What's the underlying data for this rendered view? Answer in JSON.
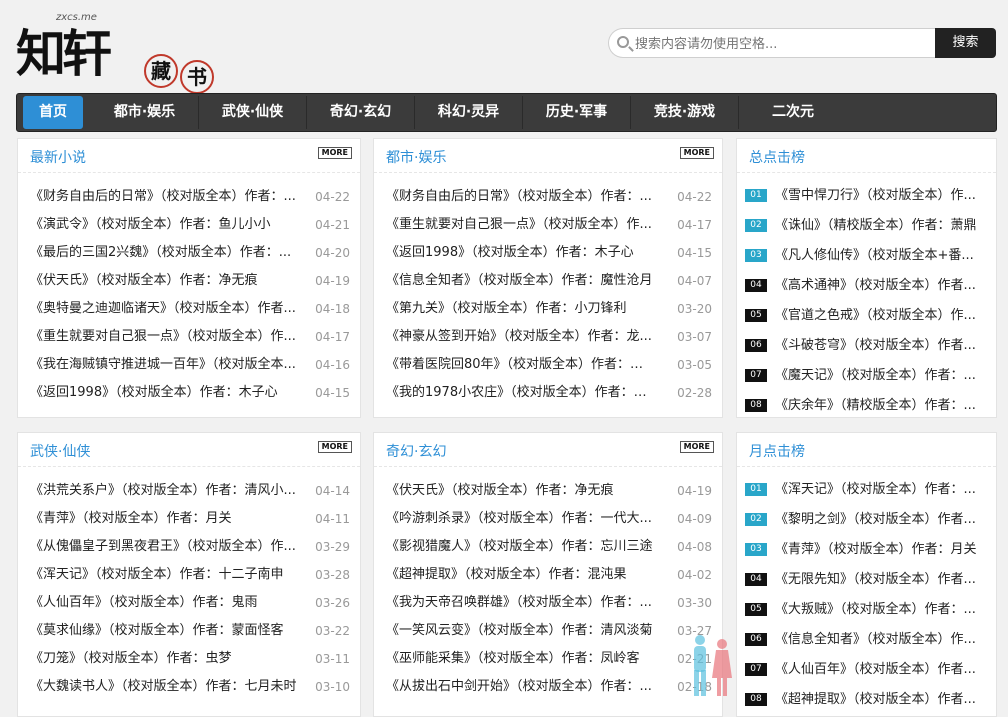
{
  "logo": {
    "main": "知轩",
    "url": "zxcs.me",
    "seal1": "藏",
    "seal2": "书"
  },
  "search": {
    "placeholder": "搜索内容请勿使用空格...",
    "button": "搜索"
  },
  "nav": [
    "首页",
    "都市·娱乐",
    "武侠·仙侠",
    "奇幻·玄幻",
    "科幻·灵异",
    "历史·军事",
    "竞技·游戏",
    "二次元"
  ],
  "more_label": "MORE",
  "panels": {
    "latest": {
      "title": "最新小说",
      "items": [
        {
          "text": "《财务自由后的日常》（校对版全本）作者：...",
          "date": "04-22"
        },
        {
          "text": "《演武令》（校对版全本）作者：鱼儿小小",
          "date": "04-21"
        },
        {
          "text": "《最后的三国2兴魏》（校对版全本）作者：...",
          "date": "04-20"
        },
        {
          "text": "《伏天氏》（校对版全本）作者：净无痕",
          "date": "04-19"
        },
        {
          "text": "《奥特曼之迪迦临诸天》（校对版全本）作者...",
          "date": "04-18"
        },
        {
          "text": "《重生就要对自己狠一点》（校对版全本）作...",
          "date": "04-17"
        },
        {
          "text": "《我在海贼镇守推进城一百年》（校对版全本...",
          "date": "04-16"
        },
        {
          "text": "《返回1998》（校对版全本）作者：木子心",
          "date": "04-15"
        }
      ]
    },
    "urban": {
      "title": "都市·娱乐",
      "items": [
        {
          "text": "《财务自由后的日常》（校对版全本）作者：...",
          "date": "04-22"
        },
        {
          "text": "《重生就要对自己狠一点》（校对版全本）作...",
          "date": "04-17"
        },
        {
          "text": "《返回1998》（校对版全本）作者：木子心",
          "date": "04-15"
        },
        {
          "text": "《信息全知者》（校对版全本）作者：魔性沧月",
          "date": "04-07"
        },
        {
          "text": "《第九关》（校对版全本）作者：小刀锋利",
          "date": "03-20"
        },
        {
          "text": "《神豪从签到开始》（校对版全本）作者：龙...",
          "date": "03-07"
        },
        {
          "text": "《带着医院回80年》（校对版全本）作者：烤饺",
          "date": "03-05"
        },
        {
          "text": "《我的1978小农庄》（校对版全本）作者：名窑",
          "date": "02-28"
        }
      ]
    },
    "total_clicks": {
      "title": "总点击榜",
      "items": [
        {
          "num": "01",
          "text": "《雪中悍刀行》（校对版全本）作..."
        },
        {
          "num": "02",
          "text": "《诛仙》（精校版全本）作者：萧鼎"
        },
        {
          "num": "03",
          "text": "《凡人修仙传》（校对版全本+番..."
        },
        {
          "num": "04",
          "text": "《高术通神》（校对版全本）作者..."
        },
        {
          "num": "05",
          "text": "《官道之色戒》（校对版全本）作..."
        },
        {
          "num": "06",
          "text": "《斗破苍穹》（校对版全本）作者..."
        },
        {
          "num": "07",
          "text": "《魔天记》（校对版全本）作者：..."
        },
        {
          "num": "08",
          "text": "《庆余年》（精校版全本）作者：..."
        }
      ]
    },
    "wuxia": {
      "title": "武侠·仙侠",
      "items": [
        {
          "text": "《洪荒关系户》（校对版全本）作者：清风小...",
          "date": "04-14"
        },
        {
          "text": "《青萍》（校对版全本）作者：月关",
          "date": "04-11"
        },
        {
          "text": "《从傀儡皇子到黑夜君王》（校对版全本）作...",
          "date": "03-29"
        },
        {
          "text": "《浑天记》（校对版全本）作者：十二子南申",
          "date": "03-28"
        },
        {
          "text": "《人仙百年》（校对版全本）作者：鬼雨",
          "date": "03-26"
        },
        {
          "text": "《莫求仙缘》（校对版全本）作者：蒙面怪客",
          "date": "03-22"
        },
        {
          "text": "《刀笼》（校对版全本）作者：虫梦",
          "date": "03-11"
        },
        {
          "text": "《大魏读书人》（校对版全本）作者：七月未时",
          "date": "03-10"
        }
      ]
    },
    "fantasy": {
      "title": "奇幻·玄幻",
      "items": [
        {
          "text": "《伏天氏》（校对版全本）作者：净无痕",
          "date": "04-19"
        },
        {
          "text": "《吟游刺杀录》（校对版全本）作者：一代大...",
          "date": "04-09"
        },
        {
          "text": "《影视猎魔人》（校对版全本）作者：忘川三途",
          "date": "04-08"
        },
        {
          "text": "《超神提取》（校对版全本）作者：混沌果",
          "date": "04-02"
        },
        {
          "text": "《我为天帝召唤群雄》（校对版全本）作者：...",
          "date": "03-30"
        },
        {
          "text": "《一笑风云变》（校对版全本）作者：清风淡菊",
          "date": "03-27"
        },
        {
          "text": "《巫师能采集》（校对版全本）作者：凤岭客",
          "date": "02-21"
        },
        {
          "text": "《从拔出石中剑开始》（校对版全本）作者：...",
          "date": "02-18"
        }
      ]
    },
    "month_clicks": {
      "title": "月点击榜",
      "items": [
        {
          "num": "01",
          "text": "《浑天记》（校对版全本）作者：..."
        },
        {
          "num": "02",
          "text": "《黎明之剑》（校对版全本）作者..."
        },
        {
          "num": "03",
          "text": "《青萍》（校对版全本）作者：月关"
        },
        {
          "num": "04",
          "text": "《无限先知》（校对版全本）作者..."
        },
        {
          "num": "05",
          "text": "《大叛贼》（校对版全本）作者：..."
        },
        {
          "num": "06",
          "text": "《信息全知者》（校对版全本）作..."
        },
        {
          "num": "07",
          "text": "《人仙百年》（校对版全本）作者..."
        },
        {
          "num": "08",
          "text": "《超神提取》（校对版全本）作者..."
        }
      ]
    }
  }
}
